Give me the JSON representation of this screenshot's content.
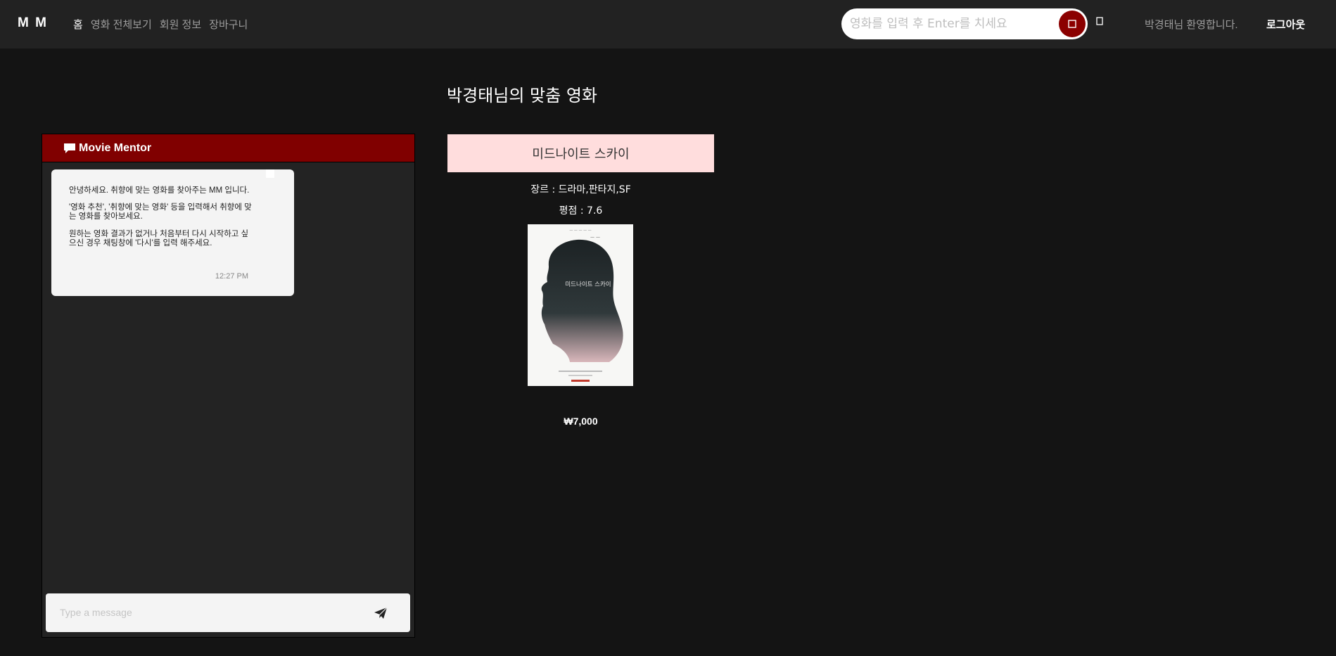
{
  "navbar": {
    "brand": "M M",
    "links": [
      {
        "label": "홈",
        "active": true
      },
      {
        "label": "영화 전체보기",
        "active": false
      },
      {
        "label": "회원 정보",
        "active": false
      },
      {
        "label": "장바구니",
        "active": false
      }
    ],
    "search_placeholder": "영화를 입력 후 Enter를 치세요",
    "search_icon": "search-icon",
    "cart_icon": "cart-icon",
    "welcome": "박경태님 환영합니다.",
    "logout": "로그아웃"
  },
  "chat": {
    "title": "Movie Mentor",
    "header_icon": "comment-icon",
    "messages": [
      {
        "paragraphs": [
          "안녕하세요. 취향에 맞는 영화를 찾아주는 MM 입니다.",
          "'영화 추천', '취향에 맞는 영화' 등을 입력해서 취향에 맞는 영화를 찾아보세요.",
          "원하는 영화 결과가 없거나 처음부터 다시 시작하고 싶으신 경우 채팅창에 '다시'를 입력 해주세요."
        ],
        "time": "12:27 PM"
      }
    ],
    "input_placeholder": "Type a message",
    "send_icon": "paper-plane-icon"
  },
  "recommendation": {
    "title": "박경태님의 맞춤 영화",
    "movie": {
      "name": "미드나이트 스카이",
      "genre": "장르 : 드라마,판타지,SF",
      "rating": "평점 : 7.6",
      "price": "₩7,000",
      "poster_title": "미드나이트 스카이"
    }
  },
  "colors": {
    "background": "#141414",
    "navbar": "#222222",
    "accent": "#8b0000",
    "chat_header": "#800000",
    "movie_name_bg": "#ffdddd"
  }
}
